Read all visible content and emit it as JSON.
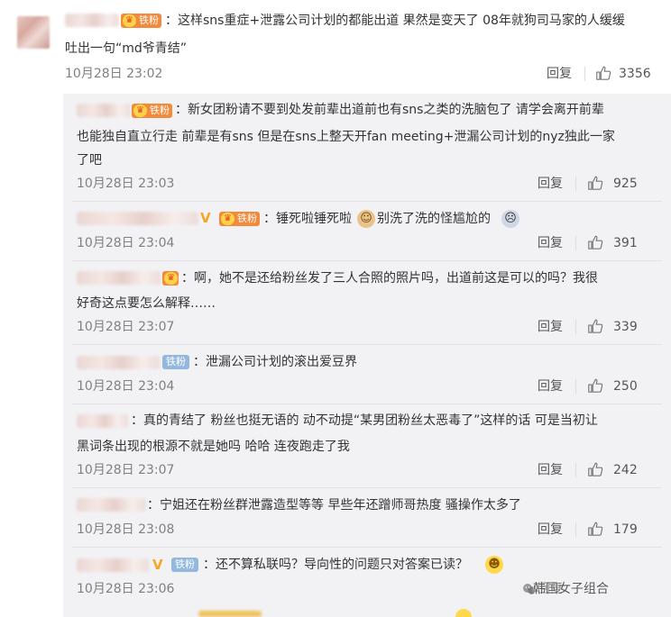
{
  "main_comment": {
    "fan_badge": "铁粉",
    "text_line1": "：这样sns重症+泄露公司计划的都能出道 果然是变天了 08年就狗司马家的人缓缓",
    "text_line2": "吐出一句“md爷青结”",
    "time": "10月28日 23:02",
    "reply_label": "回复",
    "likes": "3356"
  },
  "replies": [
    {
      "fan_badge": "铁粉",
      "text_lines": [
        "：新女团粉请不要到处发前辈出道前也有sns之类的洗脑包了 请学会离开前辈",
        "也能独自直立行走 前辈是有sns 但是在sns上整天开fan meeting+泄漏公司计划的nyz独此一家",
        "了吧"
      ],
      "time": "10月28日 23:03",
      "reply_label": "回复",
      "likes": "925"
    },
    {
      "fan_badge": "铁粉",
      "text_part1": "：锤死啦锤死啦",
      "text_part2": "别洗了洗的怪尴尬的",
      "time": "10月28日 23:04",
      "reply_label": "回复",
      "likes": "391"
    },
    {
      "text_lines": [
        "：啊，她不是还给粉丝发了三人合照的照片吗，出道前这是可以的吗？我很",
        "好奇这点要怎么解释……"
      ],
      "time": "10月28日 23:07",
      "reply_label": "回复",
      "likes": "339"
    },
    {
      "fan_badge": "铁粉",
      "text_lines": [
        "：泄漏公司计划的滚出爱豆界"
      ],
      "time": "10月28日 23:04",
      "reply_label": "回复",
      "likes": "250"
    },
    {
      "text_lines": [
        "：真的青结了 粉丝也挺无语的  动不动提“某男团粉丝太恶毒了”这样的话 可是当初让",
        "黑词条出现的根源不就是她吗 哈哈 连夜跑走了我"
      ],
      "time": "10月28日 23:07",
      "reply_label": "回复",
      "likes": "242"
    },
    {
      "text_lines": [
        "：宁姐还在粉丝群泄露造型等等 早些年还蹭师哥热度 骚操作太多了"
      ],
      "time": "10月28日 23:08",
      "reply_label": "回复",
      "likes": "179"
    },
    {
      "fan_badge": "铁粉",
      "text_lines": [
        "：还不算私联吗？导向性的问题只对答案已读？"
      ],
      "time": "10月28日 23:06",
      "reply_label": "回复"
    }
  ],
  "watermark": "韩国女子组合",
  "colors": {
    "fan_badge_orange": "#f28a3b",
    "fan_badge_blue": "#93b8de",
    "reply_panel_bg": "#f2f2f5",
    "time_gray": "#808080"
  },
  "icons": [
    "thumbs-up-icon",
    "crown-icon",
    "verified-v-icon",
    "emoji-icon",
    "wechat-icon"
  ]
}
